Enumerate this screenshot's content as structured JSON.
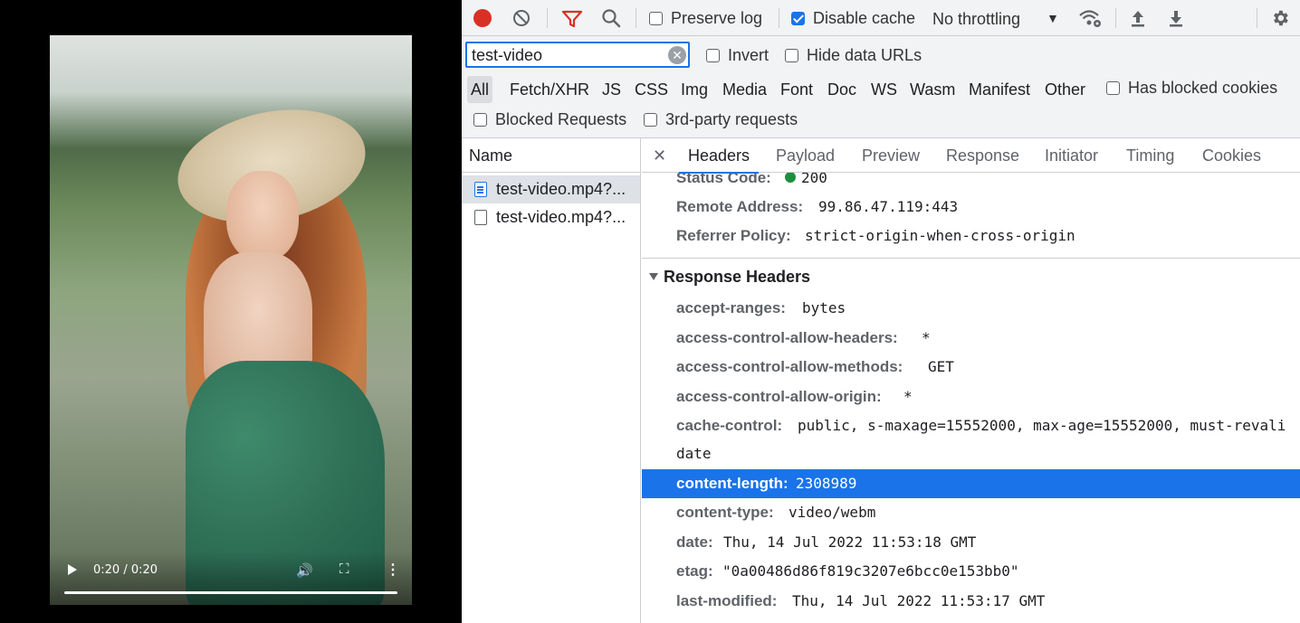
{
  "video": {
    "time": "0:20 / 0:20",
    "progress": 1.0
  },
  "toolbar": {
    "preserve_log_label": "Preserve log",
    "preserve_log_checked": false,
    "disable_cache_label": "Disable cache",
    "disable_cache_checked": true,
    "throttling_value": "No throttling"
  },
  "filter": {
    "value": "test-video",
    "invert_label": "Invert",
    "hide_data_urls_label": "Hide data URLs",
    "types": [
      "All",
      "Fetch/XHR",
      "JS",
      "CSS",
      "Img",
      "Media",
      "Font",
      "Doc",
      "WS",
      "Wasm",
      "Manifest",
      "Other"
    ],
    "active_type": "All",
    "has_blocked_cookies_label": "Has blocked cookies",
    "blocked_requests_label": "Blocked Requests",
    "third_party_label": "3rd-party requests"
  },
  "requests": {
    "header": "Name",
    "items": [
      {
        "name": "test-video.mp4?..."
      },
      {
        "name": "test-video.mp4?..."
      }
    ]
  },
  "tabs": [
    "Headers",
    "Payload",
    "Preview",
    "Response",
    "Initiator",
    "Timing",
    "Cookies"
  ],
  "active_tab": "Headers",
  "general": [
    {
      "name": "Status Code:",
      "value": "200"
    },
    {
      "name": "Remote Address:",
      "value": "99.86.47.119:443"
    },
    {
      "name": "Referrer Policy:",
      "value": "strict-origin-when-cross-origin"
    }
  ],
  "response_headers": {
    "title": "Response Headers",
    "items": [
      {
        "name": "accept-ranges:",
        "value": "bytes"
      },
      {
        "name": "access-control-allow-headers:",
        "value": "*"
      },
      {
        "name": "access-control-allow-methods:",
        "value": "GET"
      },
      {
        "name": "access-control-allow-origin:",
        "value": "*"
      },
      {
        "name": "cache-control:",
        "value": "public, s-maxage=15552000, max-age=15552000, must-revali"
      },
      {
        "name": "",
        "value": "date"
      },
      {
        "name": "content-length:",
        "value": "2308989"
      },
      {
        "name": "content-type:",
        "value": "video/webm"
      },
      {
        "name": "date:",
        "value": "Thu, 14 Jul 2022 11:53:18 GMT"
      },
      {
        "name": "etag:",
        "value": "\"0a00486d86f819c3207e6bcc0e153bb0\""
      },
      {
        "name": "last-modified:",
        "value": "Thu, 14 Jul 2022 11:53:17 GMT"
      }
    ]
  }
}
